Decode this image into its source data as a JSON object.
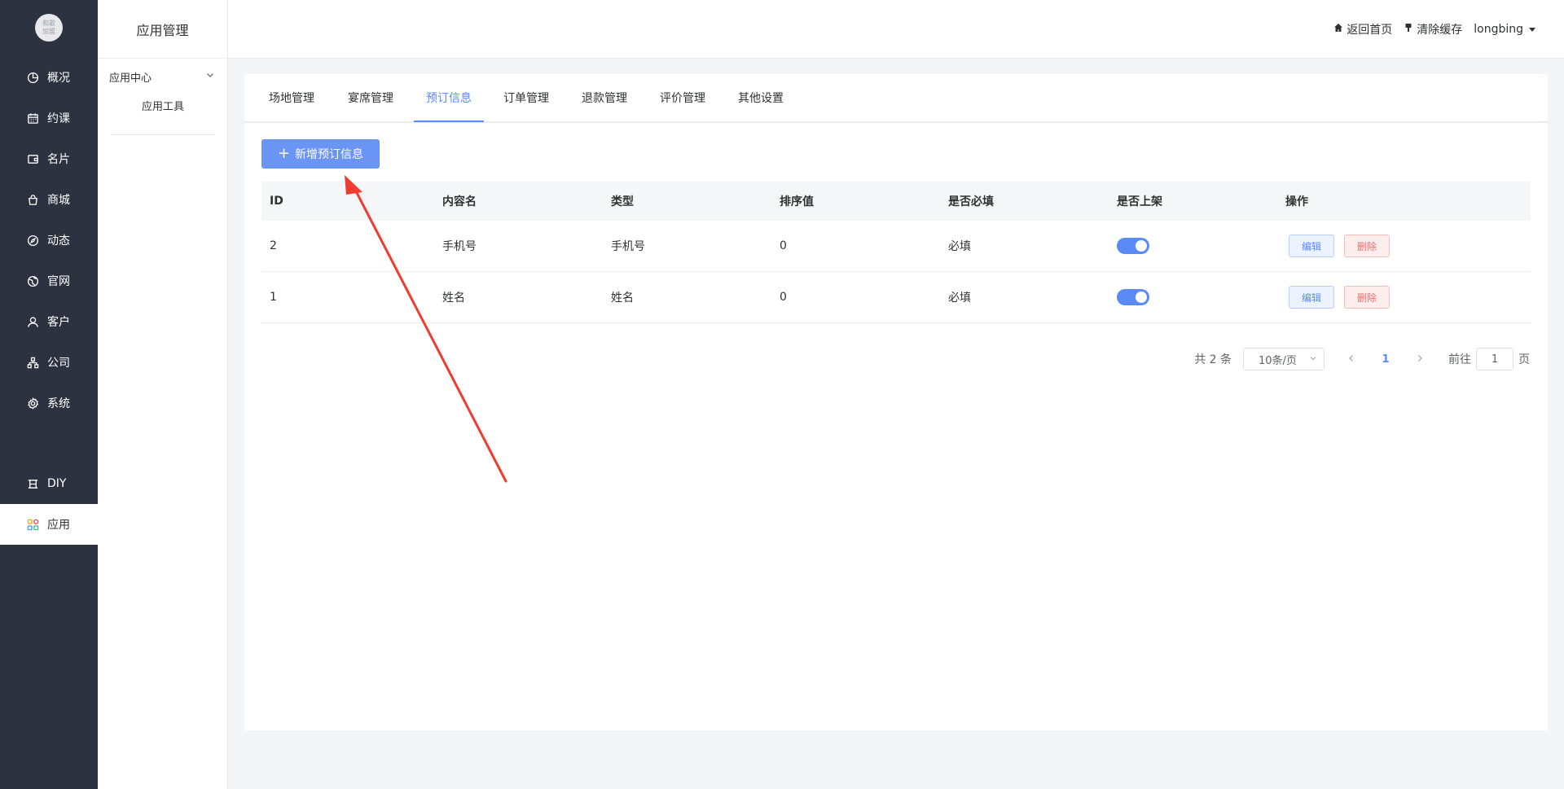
{
  "logo_text": [
    "和歌",
    "加盟"
  ],
  "leftnav": {
    "items": [
      {
        "label": "概况",
        "icon": "pie-chart-icon"
      },
      {
        "label": "约课",
        "icon": "calendar-icon"
      },
      {
        "label": "名片",
        "icon": "wallet-icon"
      },
      {
        "label": "商城",
        "icon": "shopping-bag-icon"
      },
      {
        "label": "动态",
        "icon": "compass-icon"
      },
      {
        "label": "官网",
        "icon": "globe-icon"
      },
      {
        "label": "客户",
        "icon": "user-icon"
      },
      {
        "label": "公司",
        "icon": "org-chart-icon"
      },
      {
        "label": "系统",
        "icon": "gear-icon"
      }
    ],
    "diy": {
      "label": "DIY",
      "icon": "diy-icon"
    },
    "apps": {
      "label": "应用",
      "icon": "apps-grid-icon"
    }
  },
  "subnav": {
    "title": "应用管理",
    "group_label": "应用中心",
    "sub_item": "应用工具"
  },
  "header": {
    "home_label": "返回首页",
    "clear_cache_label": "清除缓存",
    "username": "longbing"
  },
  "tabs": [
    "场地管理",
    "宴席管理",
    "预订信息",
    "订单管理",
    "退款管理",
    "评价管理",
    "其他设置"
  ],
  "active_tab": "预订信息",
  "add_button_label": "新增预订信息",
  "table": {
    "columns": [
      "ID",
      "内容名",
      "类型",
      "排序值",
      "是否必填",
      "是否上架",
      "操作"
    ],
    "rows": [
      {
        "id": "2",
        "name": "手机号",
        "type": "手机号",
        "sort": "0",
        "required": "必填",
        "on_shelf": true
      },
      {
        "id": "1",
        "name": "姓名",
        "type": "姓名",
        "sort": "0",
        "required": "必填",
        "on_shelf": true
      }
    ],
    "edit_label": "编辑",
    "delete_label": "删除"
  },
  "pagination": {
    "total_label": "共 2 条",
    "page_size": "10条/页",
    "current_page": "1",
    "goto_label": "前往",
    "goto_value": "1",
    "page_unit": "页"
  },
  "colors": {
    "sidebar_bg": "#2c3240",
    "accent": "#5b8af5",
    "danger": "#f56c6c",
    "annotation_arrow": "#f03c30"
  }
}
